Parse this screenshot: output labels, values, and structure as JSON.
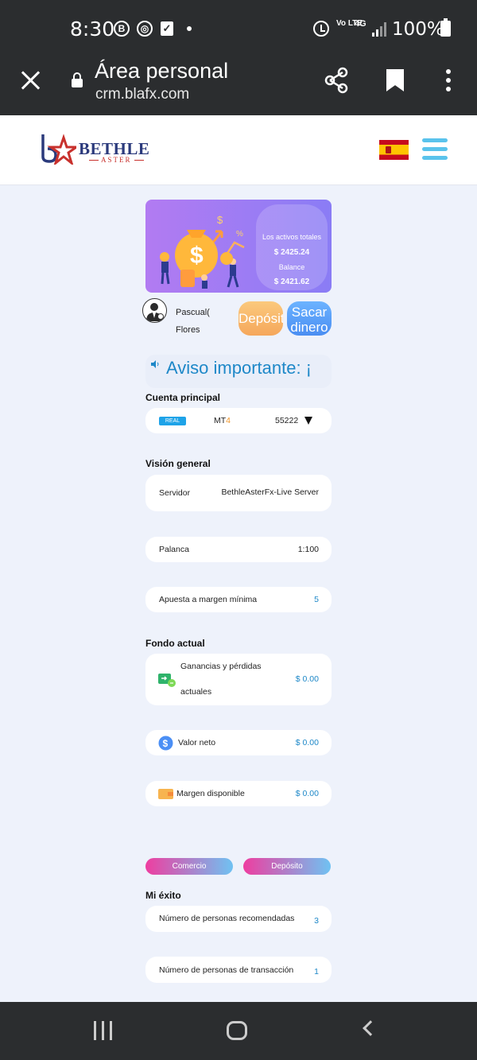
{
  "status_bar": {
    "time": "8:30",
    "battery": "100%",
    "network_volte": "Vo LTE",
    "network_type": "4G"
  },
  "browser": {
    "title": "Área personal",
    "url": "crm.blafx.com"
  },
  "header": {
    "logo_name": "BETHLE",
    "logo_sub": "ASTER"
  },
  "banner": {
    "total_assets_label": "Los activos totales",
    "total_assets_value": "$ 2425.24",
    "balance_label": "Balance",
    "balance_value": "$ 2421.62"
  },
  "user": {
    "name_line1": "Pascual(",
    "name_line2": "Flores",
    "deposit_label": "Depósito",
    "withdraw_label": "Sacar dinero"
  },
  "notice": {
    "text": "Aviso importante: ¡"
  },
  "account": {
    "section_title": "Cuenta principal",
    "type_badge": "REAL",
    "platform_prefix": "MT",
    "platform_version": "4",
    "number": "55222"
  },
  "overview": {
    "section_title": "Visión general",
    "server_label": "Servidor",
    "server_value": "BethleAsterFx-Live Server",
    "leverage_label": "Palanca",
    "leverage_value": "1:100",
    "min_margin_label": "Apuesta a margen mínima",
    "min_margin_value": "5"
  },
  "funds": {
    "section_title": "Fondo actual",
    "pnl_label_line1": "Ganancias y pérdidas",
    "pnl_label_line2": "actuales",
    "pnl_value": "$ 0.00",
    "net_value_label": "Valor neto",
    "net_value_value": "$ 0.00",
    "free_margin_label": "Margen disponible",
    "free_margin_value": "$ 0.00"
  },
  "actions": {
    "trade_label": "Comercio",
    "deposit_label": "Depósito"
  },
  "success": {
    "section_title": "Mi éxito",
    "referrals_label": "Número de personas recomendadas",
    "referrals_value": "3",
    "traders_label": "Número de personas de transacción",
    "traders_value": "1"
  },
  "colors": {
    "accent_blue": "#1e88c8",
    "brand_navy": "#2b3a7c",
    "brand_red": "#c8312d",
    "deposit_orange": "#f5a75b",
    "menu_cyan": "#5ac3ec"
  }
}
